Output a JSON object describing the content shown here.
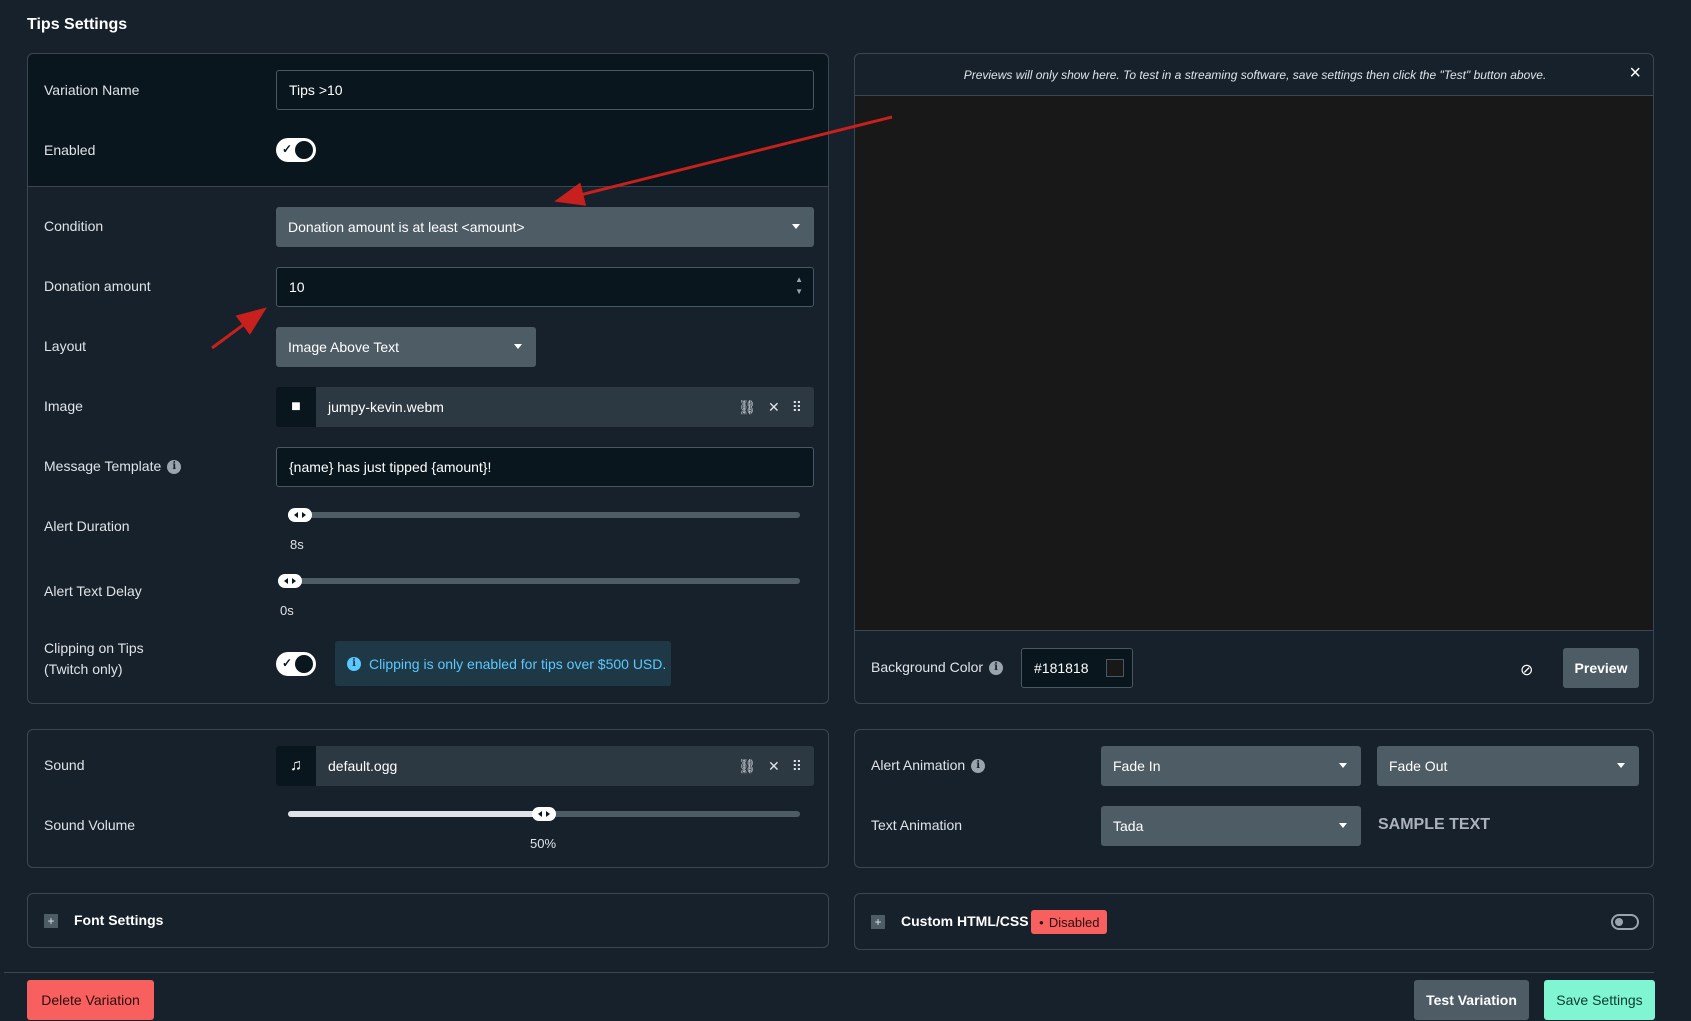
{
  "page": {
    "title": "Tips Settings"
  },
  "form": {
    "variation_name_label": "Variation Name",
    "variation_name_value": "Tips >10",
    "enabled_label": "Enabled",
    "condition_label": "Condition",
    "condition_value": "Donation amount is at least <amount>",
    "donation_amount_label": "Donation amount",
    "donation_amount_value": "10",
    "layout_label": "Layout",
    "layout_value": "Image Above Text",
    "image_label": "Image",
    "image_file": "jumpy-kevin.webm",
    "message_template_label": "Message Template",
    "message_template_value": "{name} has just tipped {amount}!",
    "alert_duration_label": "Alert Duration",
    "alert_duration_value": "8s",
    "alert_duration_fraction": 0.02,
    "alert_text_delay_label": "Alert Text Delay",
    "alert_text_delay_value": "0s",
    "alert_text_delay_fraction": 0.0,
    "clipping_label_line1": "Clipping on Tips",
    "clipping_label_line2": "(Twitch only)",
    "clipping_info": "Clipping is only enabled for tips over $500 USD."
  },
  "preview": {
    "notice": "Previews will only show here. To test in a streaming software, save settings then click the \"Test\" button above.",
    "close_icon": "×",
    "background_color_label": "Background Color",
    "background_color_value": "#181818",
    "preview_button": "Preview"
  },
  "sound": {
    "sound_label": "Sound",
    "sound_file": "default.ogg",
    "volume_label": "Sound Volume",
    "volume_value": "50%",
    "volume_fraction": 0.5
  },
  "animation": {
    "alert_animation_label": "Alert Animation",
    "alert_in": "Fade In",
    "alert_out": "Fade Out",
    "text_animation_label": "Text Animation",
    "text_animation_value": "Tada",
    "sample_text": "SAMPLE TEXT"
  },
  "font_settings": {
    "label": "Font Settings"
  },
  "custom_html": {
    "label": "Custom HTML/CSS",
    "status": "Disabled"
  },
  "footer": {
    "delete": "Delete Variation",
    "test": "Test Variation",
    "save": "Save Settings"
  },
  "colors": {
    "background": "#17212b",
    "danger": "#f85f5f",
    "success": "#80f5d2",
    "secondary": "#4e5c66",
    "info_text": "#5bc8ff"
  }
}
